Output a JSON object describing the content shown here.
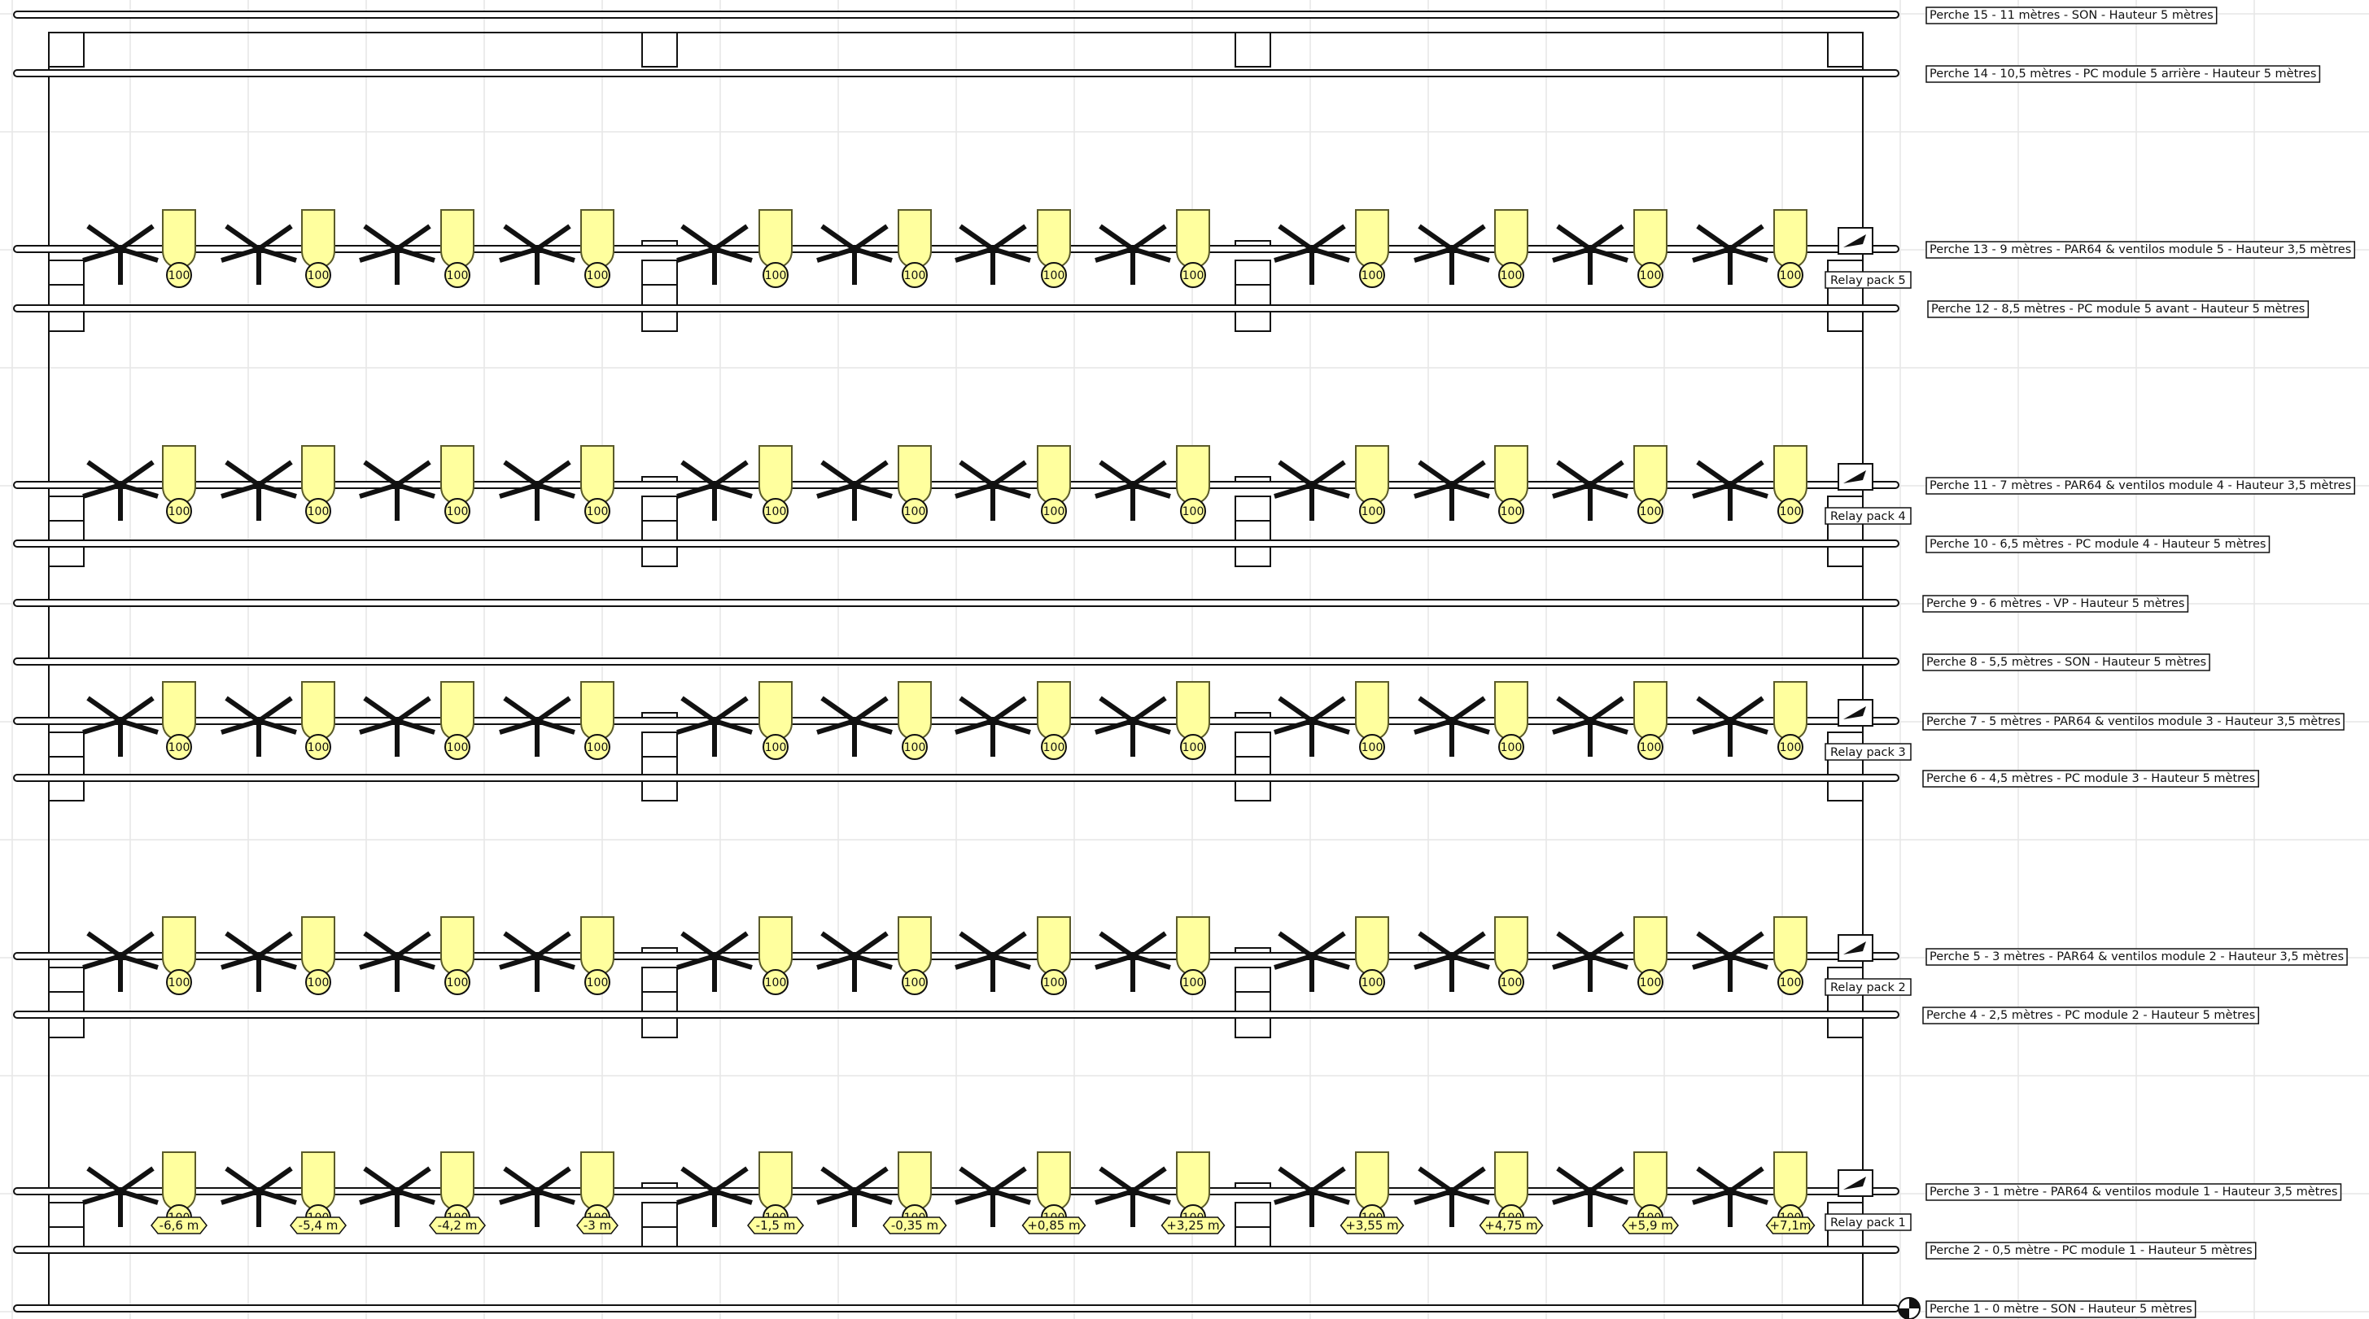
{
  "colors": {
    "background": "#ffffff",
    "grid": "#e6e6e6",
    "line": "#111111",
    "fixture_fill": "#ffff9e",
    "fixture_stroke": "#5a5a2a"
  },
  "pipes": [
    {
      "id": 15,
      "label": "Perche 15 - 11 mètres - SON - Hauteur 5 mètres",
      "kind": "plain"
    },
    {
      "id": 14,
      "label": "Perche 14 - 10,5 mètres - PC module 5 arrière - Hauteur 5 mètres",
      "kind": "pc"
    },
    {
      "id": 13,
      "label": "Perche 13 - 9 mètres - PAR64 & ventilos module 5 - Hauteur 3,5 mètres",
      "kind": "par",
      "relay": "Relay pack 5"
    },
    {
      "id": 12,
      "label": "Perche 12 - 8,5 mètres - PC module 5 avant - Hauteur 5 mètres",
      "kind": "pc"
    },
    {
      "id": 11,
      "label": "Perche 11 - 7 mètres - PAR64 & ventilos module 4 - Hauteur 3,5 mètres",
      "kind": "par",
      "relay": "Relay pack 4"
    },
    {
      "id": 10,
      "label": "Perche 10 - 6,5 mètres - PC module 4 - Hauteur 5 mètres",
      "kind": "pc"
    },
    {
      "id": 9,
      "label": "Perche 9 - 6 mètres - VP - Hauteur 5 mètres",
      "kind": "plain"
    },
    {
      "id": 8,
      "label": "Perche 8 - 5,5 mètres - SON - Hauteur 5 mètres",
      "kind": "plain"
    },
    {
      "id": 7,
      "label": "Perche 7 - 5 mètres - PAR64 & ventilos module 3 - Hauteur 3,5 mètres",
      "kind": "par",
      "relay": "Relay pack 3"
    },
    {
      "id": 6,
      "label": "Perche 6 - 4,5 mètres - PC module 3 - Hauteur 5 mètres",
      "kind": "pc"
    },
    {
      "id": 5,
      "label": "Perche 5 - 3 mètres - PAR64 & ventilos module 2 - Hauteur 3,5 mètres",
      "kind": "par",
      "relay": "Relay pack 2"
    },
    {
      "id": 4,
      "label": "Perche 4 - 2,5 mètres - PC module 2 - Hauteur 5 mètres",
      "kind": "pc"
    },
    {
      "id": 3,
      "label": "Perche 3 - 1 mètre - PAR64 & ventilos module 1 - Hauteur 3,5 mètres",
      "kind": "par",
      "relay": "Relay pack 1"
    },
    {
      "id": 2,
      "label": "Perche 2 - 0,5 mètre - PC module 1 - Hauteur 5 mètres",
      "kind": "pc"
    },
    {
      "id": 1,
      "label": "Perche 1 - 0 mètre - SON - Hauteur 5 mètres",
      "kind": "plain"
    }
  ],
  "fixture_level": "100",
  "fixture_count_per_pipe": 12,
  "position_labels": [
    "-6,6 m",
    "-5,4 m",
    "-4,2 m",
    "-3 m",
    "-1,5 m",
    "-0,35 m",
    "+0,85 m",
    "+3,25 m",
    "+3,55 m",
    "+4,75 m",
    "+5,9 m",
    "+7,1m"
  ]
}
